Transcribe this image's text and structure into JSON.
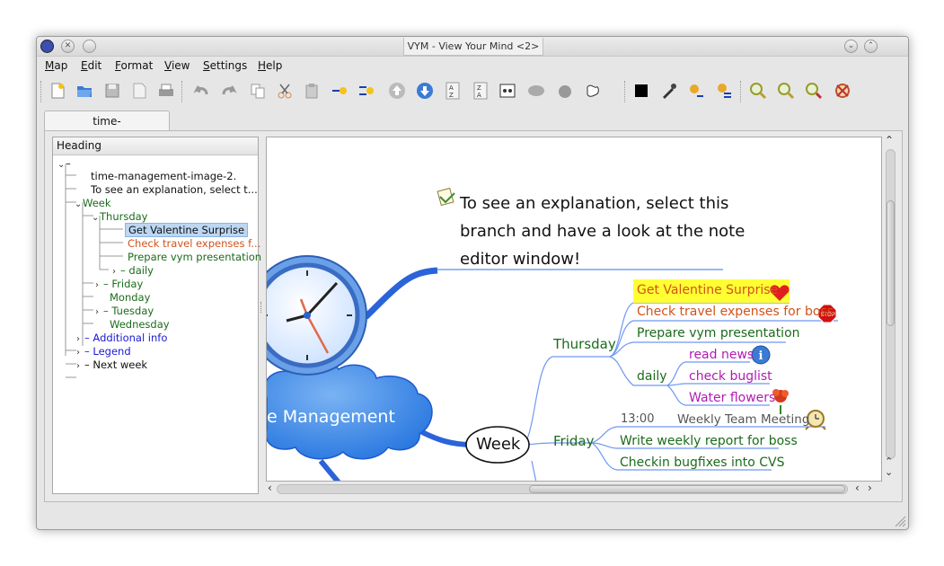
{
  "window": {
    "title": "VYM - View Your Mind <2>"
  },
  "menu": [
    {
      "label": "Map",
      "ul": "M",
      "rest": "ap"
    },
    {
      "label": "Edit",
      "ul": "E",
      "rest": "dit"
    },
    {
      "label": "Format",
      "ul": "F",
      "rest": "ormat"
    },
    {
      "label": "View",
      "ul": "V",
      "rest": "iew"
    },
    {
      "label": "Settings",
      "ul": "S",
      "rest": "ettings"
    },
    {
      "label": "Help",
      "ul": "H",
      "rest": "elp"
    }
  ],
  "tabs": [
    {
      "label": "time-management.vym"
    }
  ],
  "tree": {
    "header": "Heading",
    "rows": [
      {
        "label": "time-management-image-2.",
        "color": "#111"
      },
      {
        "label": "To see an explanation, select t...",
        "color": "#111"
      },
      {
        "label": "Week",
        "color": "#1b6b1b"
      },
      {
        "label": "Thursday",
        "color": "#1b6b1b"
      },
      {
        "label": "Get Valentine Surprise",
        "color": "#111"
      },
      {
        "label": "Check travel expenses f...",
        "color": "#d2521b"
      },
      {
        "label": "Prepare vym presentation",
        "color": "#1b6b1b"
      },
      {
        "label": "daily",
        "color": "#1b6b1b"
      },
      {
        "label": "Friday",
        "color": "#1b6b1b"
      },
      {
        "label": "Monday",
        "color": "#1b6b1b"
      },
      {
        "label": "Tuesday",
        "color": "#1b6b1b"
      },
      {
        "label": "Wednesday",
        "color": "#1b6b1b"
      },
      {
        "label": "Additional info",
        "color": "#1a1ad0"
      },
      {
        "label": "Legend",
        "color": "#1a1ad0"
      },
      {
        "label": "Next week",
        "color": "#111"
      }
    ]
  },
  "map": {
    "note_lines": [
      "To see an explanation, select this",
      "branch and have a look at the note",
      "editor window!"
    ],
    "central": "e Management",
    "week": "Week",
    "thursday": "Thursday",
    "friday": "Friday",
    "daily": "daily",
    "valentine": "Get Valentine Surprise",
    "travel": "Check travel expenses for boss",
    "prepare": "Prepare vym presentation",
    "read_news": "read news",
    "check_buglist": "check buglist",
    "water_flowers": "Water flowers",
    "time": "13:00",
    "meeting": "Weekly Team Meeting",
    "weekly_report": "Write weekly report for boss",
    "checkin": "Checkin bugfixes into CVS",
    "stop_label": "STOP",
    "info_label": "i"
  },
  "colors": {
    "green": "#1b6b1b",
    "orange": "#d2521b",
    "purple": "#b21bb2",
    "blue_link": "#3d73d8",
    "highlight": "#ffff33"
  },
  "icons": [
    "new-map-icon",
    "open-icon",
    "save-icon",
    "save-as-icon",
    "print-icon",
    "undo-icon",
    "redo-icon",
    "copy-icon",
    "cut-icon",
    "paste-icon",
    "add-branch-icon",
    "add-branch-above-icon",
    "move-up-icon",
    "move-down-icon",
    "sort-az-icon",
    "sort-za-icon",
    "link-icon",
    "hide-icon",
    "wait-icon",
    "collapse-icon",
    "color-black-icon",
    "color-picker-icon",
    "format-copy-icon",
    "format-paste-icon",
    "zoom-in-icon",
    "zoom-out-icon",
    "zoom-reset-icon",
    "center-icon"
  ]
}
